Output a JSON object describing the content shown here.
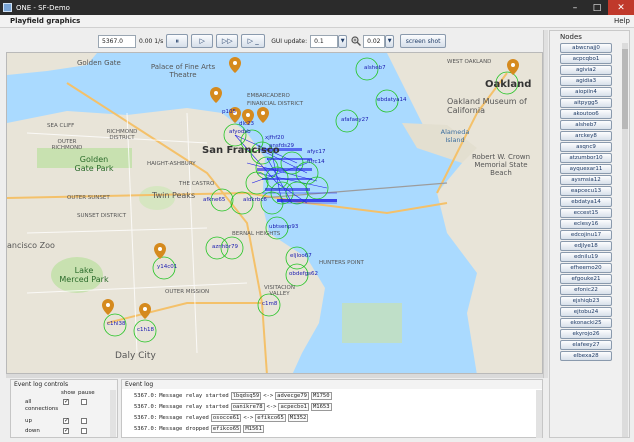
{
  "window": {
    "title": "ONE - SF-Demo"
  },
  "menubar": {
    "panel_title": "Playfield graphics",
    "help": "Help"
  },
  "toolbar": {
    "sim_time": "5367.0",
    "speed": "0.00 1/s",
    "pause_symbol": "⏸",
    "step_symbol": "▷",
    "ff_symbol": "▷▷",
    "until_symbol": "▷ _",
    "gui_update_label": "GUI update:",
    "gui_update_value": "0.1",
    "zoom_icon": "magnifier-icon",
    "zoom_value": "0.02",
    "screenshot_label": "screen shot"
  },
  "map": {
    "places": [
      "Golden Gate",
      "Palace of Fine Arts Theatre",
      "SEA CLIFF",
      "RICHMOND DISTRICT",
      "OUTER RICHMOND",
      "Golden Gate Park",
      "HAIGHT-ASHBURY",
      "San Francisco",
      "Twin Peaks",
      "THE CASTRO",
      "OUTER SUNSET",
      "SUNSET DISTRICT",
      "BERNAL HEIGHTS",
      "HUNTERS POINT",
      "Lake Merced Park",
      "OUTER MISSION",
      "VISITACION VALLEY",
      "Daly City",
      "EMBARCADERO",
      "FINANCIAL DISTRICT",
      "WEST OAKLAND",
      "Oakland",
      "Oakland Museum of California",
      "Alameda Island",
      "Robert W. Crown Memorial State Beach",
      "ancisco Zoo"
    ],
    "nodes": [
      "alsheb7",
      "ebdatya14",
      "afafaey27",
      "p105",
      "dlc23",
      "afyodsb",
      "xjfhf20",
      "ansfds29",
      "afyc17",
      "fifrc14",
      "afkne65",
      "aldkrbc6",
      "ubtsenp93",
      "aznhbr79",
      "eljloo67",
      "obdefgs62",
      "y14c01",
      "c1m8",
      "c1hl38",
      "c1h18"
    ]
  },
  "nodes_panel": {
    "title": "Nodes",
    "items": [
      "abwcnajj0",
      "acpcqbo1",
      "agivia2",
      "agidia3",
      "aiopiln4",
      "aitpygg5",
      "akoutoo6",
      "alsheb7",
      "arckey8",
      "asqnc9",
      "atzumbor10",
      "ayquexar11",
      "aysmsia12",
      "eapcecu13",
      "ebdatya14",
      "eccest15",
      "eclesy16",
      "edcojinu17",
      "edjlye18",
      "ednilu19",
      "efheemo20",
      "efgouke21",
      "efonic22",
      "ejshiqb23",
      "ejtobu24",
      "ekonacki25",
      "ekyrojo26",
      "elafeey27",
      "elbexa28"
    ]
  },
  "event_controls": {
    "title": "Event log controls",
    "col_show": "show",
    "col_pause": "pause",
    "rows": [
      {
        "label": "all connections",
        "show": true,
        "pause": false
      },
      {
        "label": "up",
        "show": true,
        "pause": false
      },
      {
        "label": "down",
        "show": true,
        "pause": false
      }
    ]
  },
  "event_log": {
    "title": "Event log",
    "lines": [
      {
        "time": "5367.0:",
        "text": "Message relay started",
        "a": "lbqdsq59",
        "sep": "<->",
        "b": "advecge79",
        "msg": "M1750"
      },
      {
        "time": "5367.0:",
        "text": "Message relay started",
        "a": "oanikre78",
        "sep": "<->",
        "b": "acpecbo1",
        "msg": "M1653"
      },
      {
        "time": "5367.0:",
        "text": "Message relayed",
        "a": "osocce61",
        "sep": "<->",
        "b": "efikco65",
        "msg": "M1352"
      },
      {
        "time": "5367.0:",
        "text": "Message dropped",
        "a": "efikco65",
        "sep": "",
        "b": "",
        "msg": "M1561"
      }
    ]
  },
  "colors": {
    "water": "#aadaff",
    "land": "#e8e4d8",
    "park": "#c8e1b0",
    "node_circle": "#23c423",
    "node_label": "#1a1ab0",
    "pin": "#d58a1e",
    "link": "#1e1ee6"
  }
}
